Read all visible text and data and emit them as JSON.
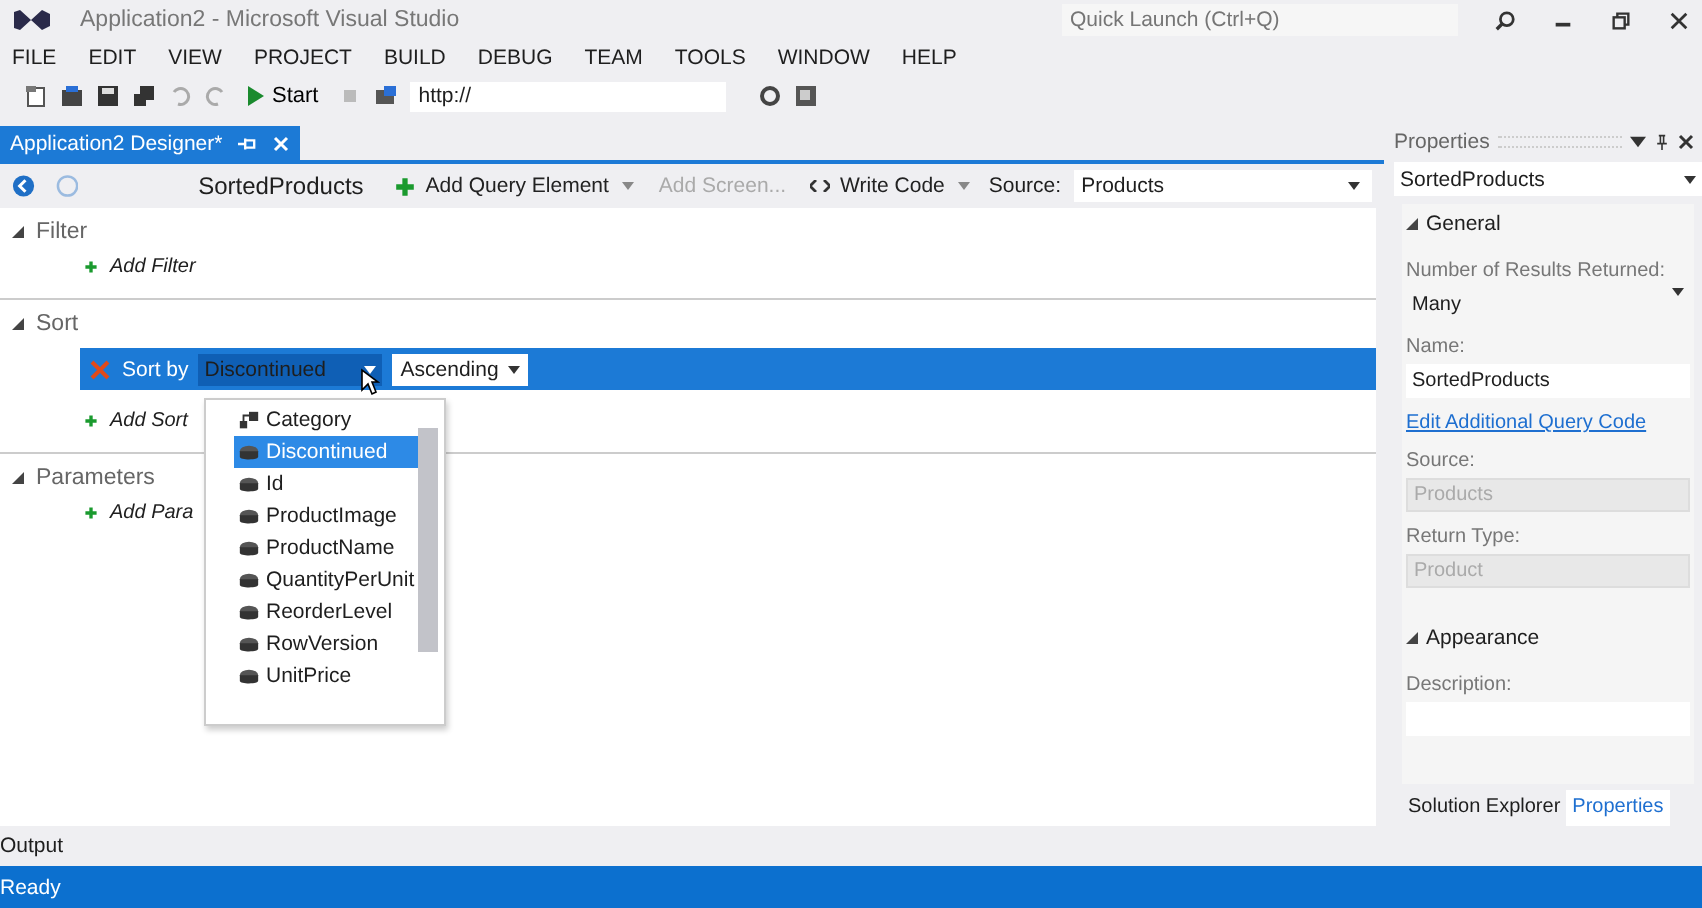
{
  "window": {
    "title": "Application2 - Microsoft Visual Studio",
    "quick_launch": {
      "placeholder": "Quick Launch (Ctrl+Q)"
    }
  },
  "menu": [
    "FILE",
    "EDIT",
    "VIEW",
    "PROJECT",
    "BUILD",
    "DEBUG",
    "TEAM",
    "TOOLS",
    "WINDOW",
    "HELP"
  ],
  "toolbar": {
    "start_label": "Start",
    "url": "http://"
  },
  "document_tab": {
    "label": "Application2 Designer*",
    "selected": true
  },
  "designer": {
    "query_name": "SortedProducts",
    "add_query_element": "Add Query Element",
    "add_screen": {
      "label": "Add Screen...",
      "disabled": true
    },
    "write_code": "Write Code",
    "source_label": "Source:",
    "source_value": "Products",
    "sections": [
      {
        "kind": "filter",
        "title": "Filter",
        "expanded": true,
        "add_label": "Add Filter"
      },
      {
        "kind": "sort",
        "title": "Sort",
        "expanded": true,
        "sort_by_label": "Sort by",
        "field": "Discontinued",
        "direction": "Ascending",
        "add_label": "Add Sort"
      },
      {
        "kind": "parameters",
        "title": "Parameters",
        "expanded": true,
        "add_label": "Add Para"
      }
    ],
    "field_list": [
      {
        "label": "Category",
        "kind": "navigation",
        "selected": false
      },
      {
        "label": "Discontinued",
        "kind": "property",
        "selected": true
      },
      {
        "label": "Id",
        "kind": "property",
        "selected": false
      },
      {
        "label": "ProductImage",
        "kind": "property",
        "selected": false
      },
      {
        "label": "ProductName",
        "kind": "property",
        "selected": false
      },
      {
        "label": "QuantityPerUnit",
        "kind": "property",
        "selected": false
      },
      {
        "label": "ReorderLevel",
        "kind": "property",
        "selected": false
      },
      {
        "label": "RowVersion",
        "kind": "property",
        "selected": false
      },
      {
        "label": "UnitPrice",
        "kind": "property",
        "selected": false
      }
    ]
  },
  "properties": {
    "title": "Properties",
    "object": "SortedProducts",
    "groups": [
      {
        "title": "General",
        "expanded": true,
        "fields": [
          {
            "kind": "dropdown",
            "label": "Number of Results Returned:",
            "value": "Many"
          },
          {
            "kind": "text",
            "label": "Name:",
            "value": "SortedProducts",
            "disabled": false
          },
          {
            "kind": "link",
            "label": "Edit Additional Query Code"
          },
          {
            "kind": "text",
            "label": "Source:",
            "value": "Products",
            "disabled": true
          },
          {
            "kind": "text",
            "label": "Return Type:",
            "value": "Product",
            "disabled": true
          }
        ]
      },
      {
        "title": "Appearance",
        "expanded": true,
        "fields": [
          {
            "kind": "text",
            "label": "Description:",
            "disabled": false
          }
        ]
      }
    ],
    "tabs": [
      {
        "label": "Solution Explorer",
        "selected": false
      },
      {
        "label": "Properties",
        "selected": true
      }
    ]
  },
  "output_tab": "Output",
  "status_bar": "Ready"
}
